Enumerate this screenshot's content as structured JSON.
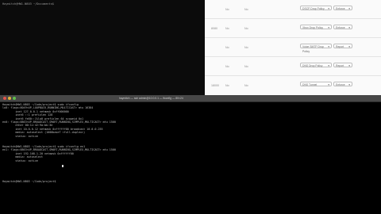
{
  "top_terminal": {
    "prompt": "Haymitch@HW1-N803 ~/Documents$"
  },
  "table_rows": [
    {
      "col1": "",
      "col2": "No",
      "col3": "No",
      "select": "DSCP Drop Policy",
      "action": "Enforce"
    },
    {
      "col1": "8080",
      "col2": "No",
      "col3": "No",
      "select": "Xbox Drop Policy",
      "action": "Enforce"
    },
    {
      "col1": "",
      "col2": "No",
      "col3": "No",
      "select": "Voice SMTP Drop Policy",
      "action": "Report"
    },
    {
      "col1": "",
      "col2": "No",
      "col3": "No",
      "select": "DNS Drop Policy",
      "action": "Report"
    },
    {
      "col1": "18000",
      "col2": "No",
      "col3": "No",
      "select": "DNS Tunnel",
      "action": "Enforce"
    }
  ],
  "bottom_terminal": {
    "window_title": "haymitch — ssh admin@10.0.0.1 — ifconfig — 80×24",
    "lines": [
      "Haymitch@HW1-N803 ~/Code/project$ sudo ifconfig",
      "lo0: flags=8049<UP,LOOPBACK,RUNNING,MULTICAST> mtu 16384",
      "        inet 127.0.0.1 netmask 0xff000000",
      "        inet6 ::1 prefixlen 128",
      "        inet6 fe80::1%lo0 prefixlen 64 scopeid 0x1",
      "en0: flags=8863<UP,BROADCAST,SMART,RUNNING,SIMPLEX,MULTICAST> mtu 1500",
      "        ether 00:1c:42:9a:bb:3e",
      "        inet 10.0.0.12 netmask 0xffffff00 broadcast 10.0.0.255",
      "        media: autoselect (1000baseT <full-duplex>)",
      "        status: active",
      "",
      "",
      "Haymitch@HW1-N803 ~/Code/project$ sudo ifconfig en1",
      "en1: flags=8863<UP,BROADCAST,SMART,RUNNING,SIMPLEX,MULTICAST> mtu 1500",
      "        inet 192.168.1.20 netmask 0xffffff00",
      "        media: autoselect",
      "        status: active",
      "",
      "",
      "",
      "",
      "",
      "Haymitch@HW1-N803 ~/Code/project$ "
    ]
  }
}
